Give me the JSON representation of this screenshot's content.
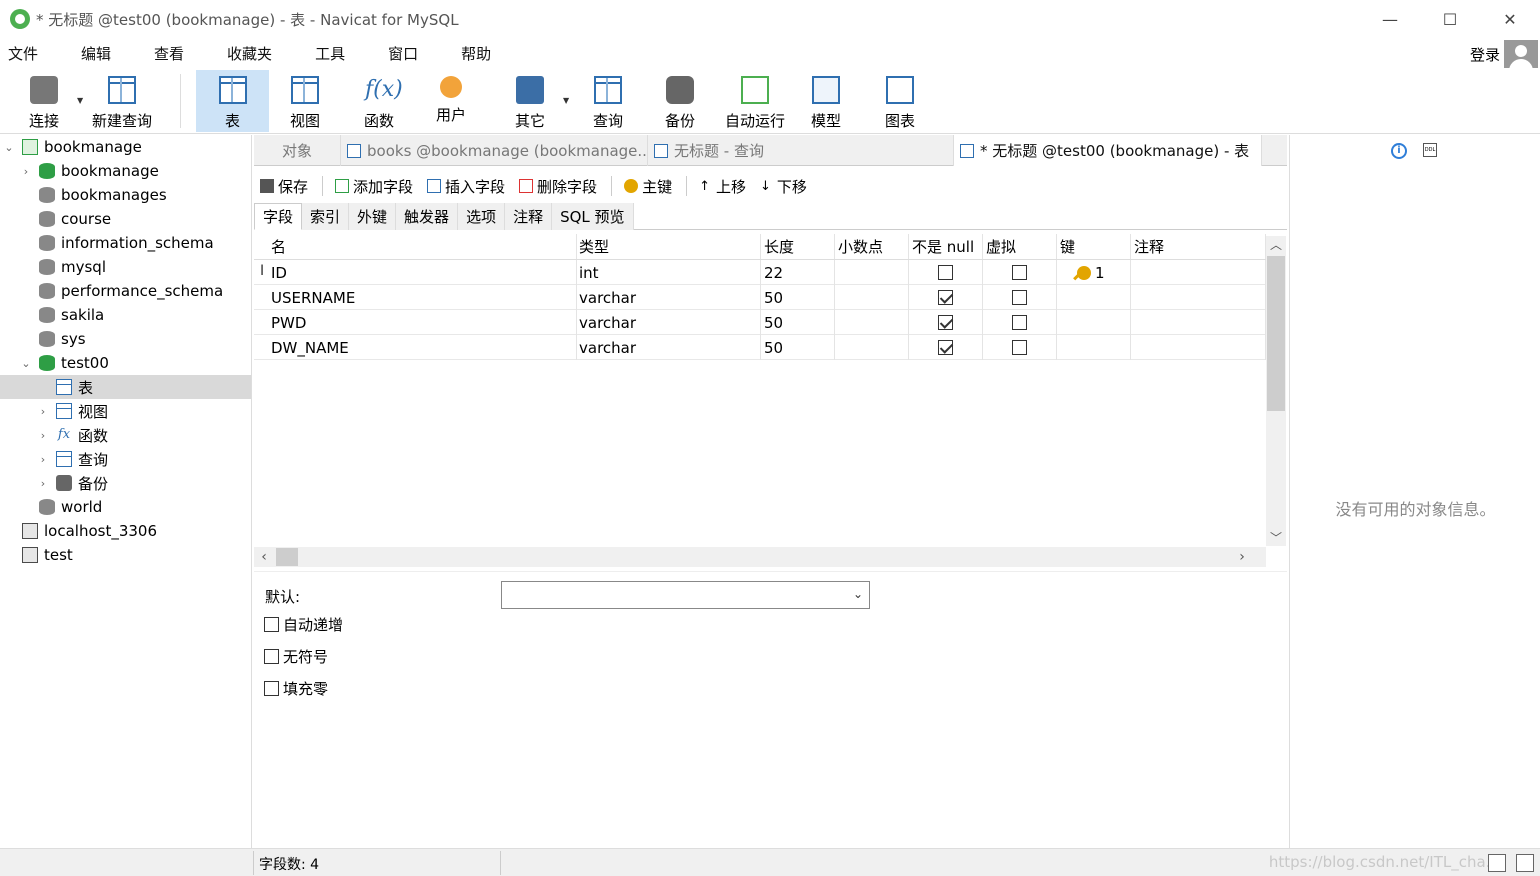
{
  "window": {
    "title": "* 无标题 @test00 (bookmanage) - 表 - Navicat for MySQL",
    "minimize": "—",
    "maximize": "☐",
    "close": "✕"
  },
  "menu": {
    "items": [
      "文件",
      "编辑",
      "查看",
      "收藏夹",
      "工具",
      "窗口",
      "帮助"
    ],
    "login": "登录"
  },
  "toolbar": {
    "connect": "连接",
    "new_query": "新建查询",
    "table": "表",
    "view": "视图",
    "function": "函数",
    "user": "用户",
    "other": "其它",
    "query": "查询",
    "backup": "备份",
    "automation": "自动运行",
    "model": "模型",
    "chart": "图表",
    "fx": "f(x)"
  },
  "tree": {
    "root": "bookmanage",
    "databases": [
      "bookmanage",
      "bookmanages",
      "course",
      "information_schema",
      "mysql",
      "performance_schema",
      "sakila",
      "sys",
      "test00"
    ],
    "test00_children": [
      "表",
      "视图",
      "函数",
      "查询",
      "备份"
    ],
    "after": [
      "world"
    ],
    "connections": [
      "localhost_3306",
      "test"
    ],
    "fx": "fx"
  },
  "tabs": {
    "objects": "对象",
    "books": "books @bookmanage (bookmanage...",
    "untitled_query": "无标题 - 查询",
    "active": "* 无标题 @test00 (bookmanage) - 表"
  },
  "editor_toolbar": {
    "save": "保存",
    "add_field": "添加字段",
    "insert_field": "插入字段",
    "delete_field": "删除字段",
    "primary_key": "主键",
    "move_up": "上移",
    "move_down": "下移"
  },
  "subtabs": [
    "字段",
    "索引",
    "外键",
    "触发器",
    "选项",
    "注释",
    "SQL 预览"
  ],
  "grid": {
    "columns": [
      "名",
      "类型",
      "长度",
      "小数点",
      "不是 null",
      "虚拟",
      "键",
      "注释"
    ],
    "rows": [
      {
        "name": "ID",
        "type": "int",
        "length": "22",
        "decimals": "",
        "not_null": false,
        "virtual": false,
        "key": "1",
        "comment": ""
      },
      {
        "name": "USERNAME",
        "type": "varchar",
        "length": "50",
        "decimals": "",
        "not_null": true,
        "virtual": false,
        "key": "",
        "comment": ""
      },
      {
        "name": "PWD",
        "type": "varchar",
        "length": "50",
        "decimals": "",
        "not_null": true,
        "virtual": false,
        "key": "",
        "comment": ""
      },
      {
        "name": "DW_NAME",
        "type": "varchar",
        "length": "50",
        "decimals": "",
        "not_null": true,
        "virtual": false,
        "key": "",
        "comment": ""
      }
    ]
  },
  "props": {
    "default_label": "默认:",
    "default_value": "",
    "auto_increment": "自动递增",
    "unsigned": "无符号",
    "zerofill": "填充零"
  },
  "info": {
    "empty": "没有可用的对象信息。",
    "info_glyph": "i",
    "ddl_glyph": "DDL"
  },
  "status": {
    "field_count": "字段数: 4",
    "watermark": "https://blog.csdn.net/ITL_cha..."
  },
  "colors": {
    "accent": "#2f6fb0",
    "selected_toolbar": "#cde3f7",
    "db_green": "#2e9e45"
  }
}
